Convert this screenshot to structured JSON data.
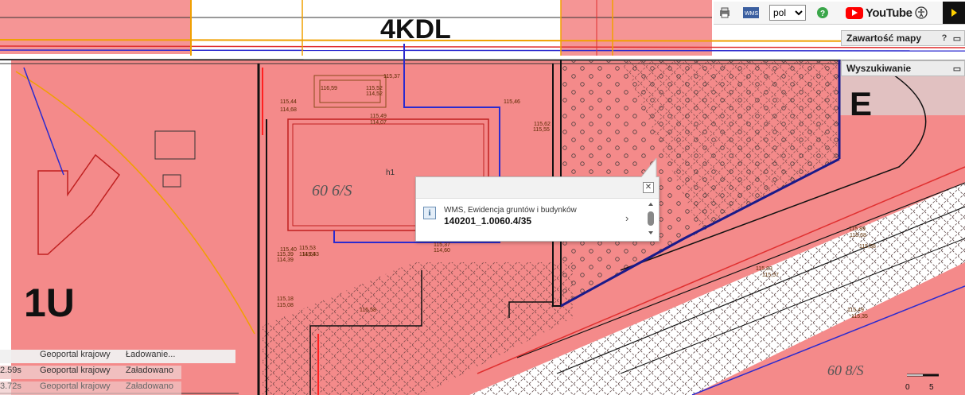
{
  "toolbar": {
    "language": "pol",
    "youtube_label": "YouTube"
  },
  "panels": {
    "contents_title": "Zawartość mapy",
    "search_title": "Wyszukiwanie"
  },
  "map_labels": {
    "zone_4kdl": "4KDL",
    "zone_1u": "1U",
    "zone_e": "E",
    "parcel_60_6s": "60 6/S",
    "parcel_60_8s": "60 8/S",
    "h1": "h1",
    "scale_0": "0",
    "scale_5": "5"
  },
  "map_elevations": [
    "115,44",
    "114,68",
    "115,49",
    "114,07",
    "115,40",
    "116,59",
    "115,52",
    "114,52",
    "115,37",
    "115,39",
    "114,39",
    "115,33",
    "115,18",
    "115,08",
    "115,58",
    "115,37",
    "114,60",
    "115,53",
    "114,64",
    "115,46",
    "115,62",
    "115,55",
    "115,89",
    "115,68",
    "115,88",
    "115,83",
    "115,57",
    "115,49",
    "115,35"
  ],
  "popup": {
    "layer_name": "WMS, Ewidencja gruntów i budynków",
    "parcel_id": "140201_1.0060.4/35"
  },
  "status_log": [
    {
      "time": "",
      "source": "Geoportal krajowy",
      "message": "Ładowanie..."
    },
    {
      "time": "2.59s",
      "source": "Geoportal krajowy",
      "message": "Załadowano"
    },
    {
      "time": "3.72s",
      "source": "Geoportal krajowy",
      "message": "Załadowano"
    }
  ],
  "colors": {
    "zone_fill": "#f48a8a",
    "road_fill": "#ffffff",
    "popup_bg": "#ffffff"
  }
}
